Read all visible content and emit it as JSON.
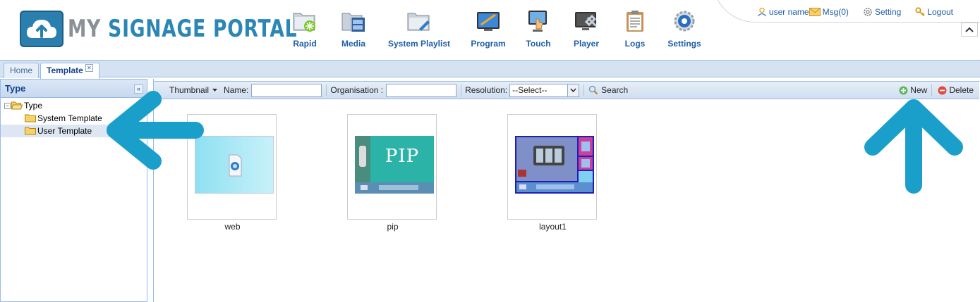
{
  "app": {
    "logo_my": "MY",
    "logo_rest": "SIGNAGE PORTAL"
  },
  "nav": [
    {
      "label": "Rapid",
      "icon": "rapid-icon"
    },
    {
      "label": "Media",
      "icon": "media-icon"
    },
    {
      "label": "System Playlist",
      "icon": "system-playlist-icon"
    },
    {
      "label": "Program",
      "icon": "program-icon"
    },
    {
      "label": "Touch",
      "icon": "touch-icon"
    },
    {
      "label": "Player",
      "icon": "player-icon"
    },
    {
      "label": "Logs",
      "icon": "logs-icon"
    },
    {
      "label": "Settings",
      "icon": "settings-icon"
    }
  ],
  "toplinks": {
    "user": "user name",
    "msg": "Msg(0)",
    "setting": "Setting",
    "logout": "Logout"
  },
  "tabs": [
    {
      "label": "Home",
      "active": false
    },
    {
      "label": "Template",
      "active": true,
      "closable": true
    }
  ],
  "left_panel": {
    "title": "Type",
    "tree": {
      "root": "Type",
      "children": [
        "System Template",
        "User Template"
      ],
      "selected": "User Template"
    }
  },
  "toolbar": {
    "view": "Thumbnail",
    "name_label": "Name:",
    "name_value": "",
    "org_label": "Organisation :",
    "org_value": "",
    "resolution_label": "Resolution:",
    "resolution_value": "--Select--",
    "search_label": "Search",
    "new_label": "New",
    "delete_label": "Delete"
  },
  "templates": [
    {
      "name": "web",
      "thumb_text": ""
    },
    {
      "name": "pip",
      "thumb_text": "PIP"
    },
    {
      "name": "layout1",
      "thumb_text": ""
    }
  ],
  "colors": {
    "accent": "#1f5ea8",
    "panel_border": "#99bbe8",
    "annotation_arrow": "#1a9fcb",
    "logo_blue": "#2a86b5"
  }
}
